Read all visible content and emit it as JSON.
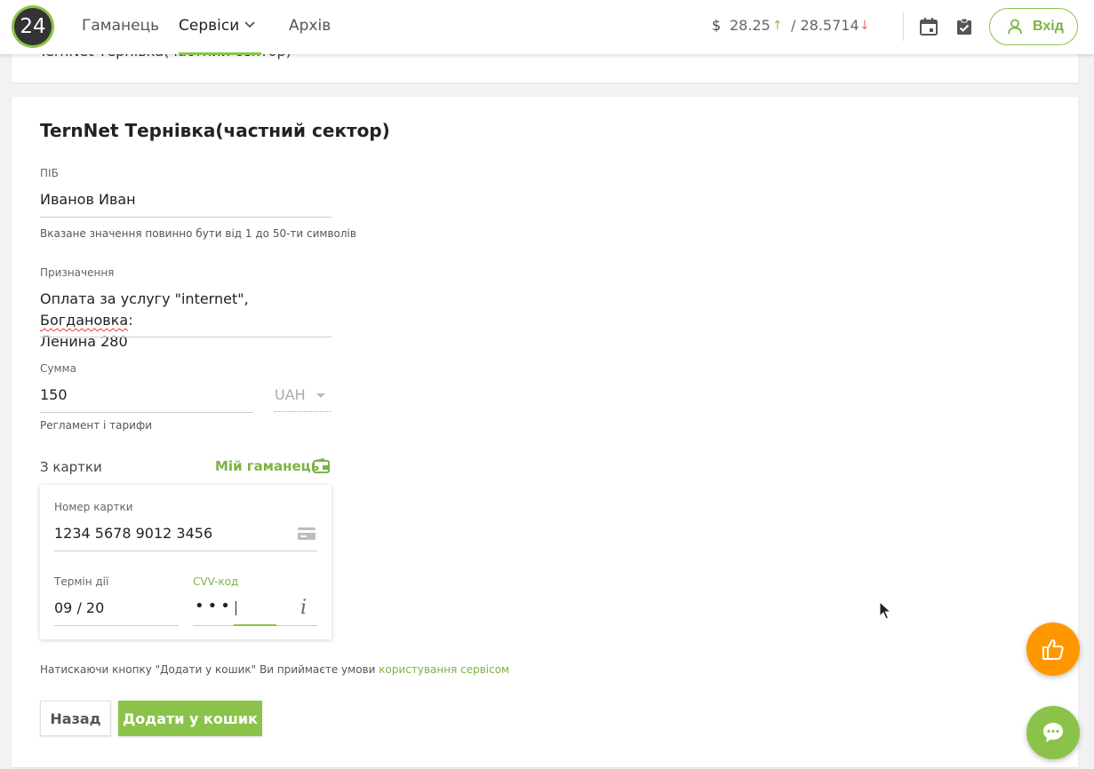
{
  "header": {
    "logo_text": "24",
    "nav": [
      {
        "label": "Гаманець"
      },
      {
        "label": "Сервіси"
      },
      {
        "label": "Архів"
      }
    ],
    "currency_symbol": "$",
    "rate_buy": "28.25",
    "rate_buy_arrow": "↑",
    "rate_sell": "/ 28.5714",
    "rate_sell_arrow": "↓",
    "login_label": "Вхід",
    "icons": [
      "calendar-icon",
      "clipboard-check-icon",
      "user-icon"
    ]
  },
  "top_card": {
    "text": "TernNet Тернівка(частний сектор)"
  },
  "form": {
    "title": "TernNet Тернівка(частний сектор)",
    "name": {
      "label": "ПІБ",
      "value": "Иванов Иван",
      "hint": "Вказане значення повинно бути від 1 до 50-ти символів"
    },
    "purpose": {
      "label": "Призначення",
      "value_pre": "Оплата за услугу \"internet\", ",
      "value_spell": "Богдановка",
      "value_post": ":",
      "value_line2": "Ленина 280"
    },
    "amount": {
      "label": "Сумма",
      "value": "150",
      "currency": "UAH",
      "hint": "Регламент і тарифи"
    },
    "source_label": "З картки",
    "wallet_link": "Мій гаманець",
    "card": {
      "number_label": "Номер картки",
      "number_value": "1234 5678 9012 3456",
      "expiry_label": "Термін дії",
      "expiry_value": "09 / 20",
      "cvv_label": "CVV-код",
      "cvv_value": "•••",
      "info_glyph": "i"
    },
    "terms_text": "Натискаючи кнопку \"Додати у кошик\" Ви приймаєте умови ",
    "terms_link": "користування сервісом",
    "back_label": "Назад",
    "add_label": "Додати у кошик"
  },
  "colors": {
    "accent": "#8bc34a",
    "accent_text": "#7cb342",
    "like_fab": "#ff9800",
    "down_arrow": "#e57373"
  }
}
